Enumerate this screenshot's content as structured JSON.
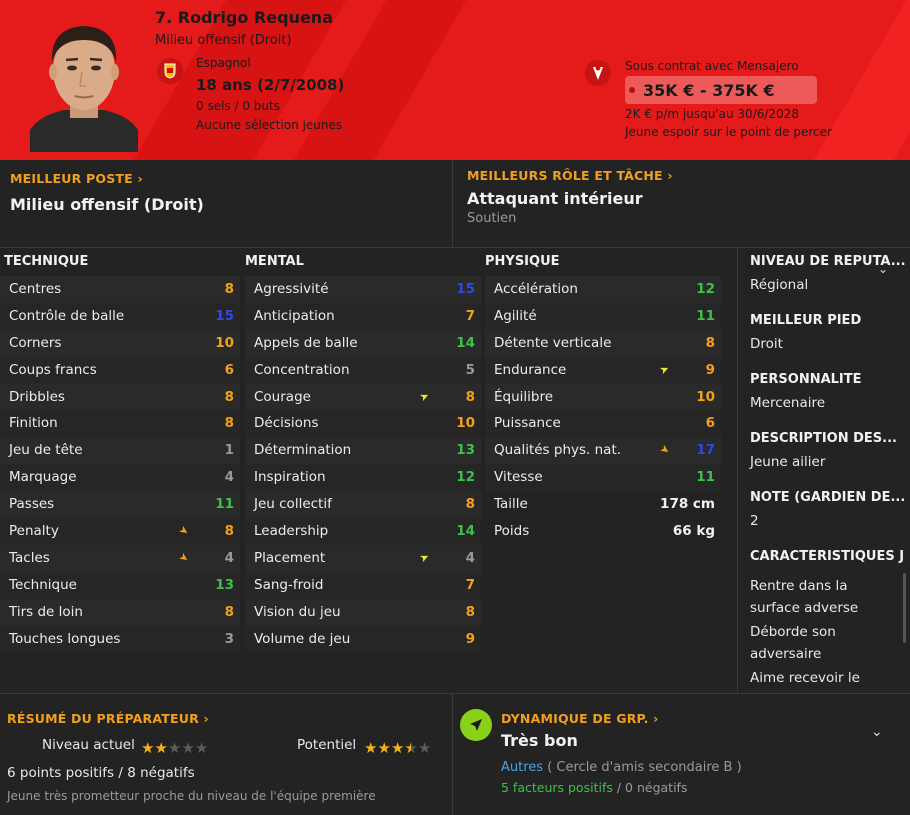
{
  "header": {
    "name": "7. Rodrigo Requena",
    "position": "Milieu offensif (Droit)",
    "nationality": "Espagnol",
    "age": "18 ans",
    "dob": "(2/7/2008)",
    "caps": "0 sels / 0 buts",
    "youth": "Aucune sélection jeunes",
    "contract": "Sous contrat avec Mensajero",
    "value": "35K € - 375K €",
    "wage": "2K € p/m jusqu'au 30/6/2028",
    "prospect": "Jeune espoir sur le point de percer"
  },
  "best_position": {
    "title": "MEILLEUR POSTE",
    "value": "Milieu offensif (Droit)"
  },
  "best_role": {
    "title": "MEILLEURS RÔLE ET TÂCHE",
    "value": "Attaquant intérieur",
    "duty": "Soutien"
  },
  "technique": {
    "title": "TECHNIQUE",
    "rows": [
      {
        "label": "Centres",
        "value": "8",
        "color": "or"
      },
      {
        "label": "Contrôle de balle",
        "value": "15",
        "color": "bl"
      },
      {
        "label": "Corners",
        "value": "10",
        "color": "or"
      },
      {
        "label": "Coups francs",
        "value": "6",
        "color": "or"
      },
      {
        "label": "Dribbles",
        "value": "8",
        "color": "or"
      },
      {
        "label": "Finition",
        "value": "8",
        "color": "or"
      },
      {
        "label": "Jeu de tête",
        "value": "1",
        "color": "gy"
      },
      {
        "label": "Marquage",
        "value": "4",
        "color": "gy"
      },
      {
        "label": "Passes",
        "value": "11",
        "color": "gr"
      },
      {
        "label": "Penalty",
        "value": "8",
        "color": "or",
        "arrow": "or"
      },
      {
        "label": "Tacles",
        "value": "4",
        "color": "gy",
        "arrow": "or"
      },
      {
        "label": "Technique",
        "value": "13",
        "color": "gr"
      },
      {
        "label": "Tirs de loin",
        "value": "8",
        "color": "or"
      },
      {
        "label": "Touches longues",
        "value": "3",
        "color": "gy"
      }
    ]
  },
  "mental": {
    "title": "MENTAL",
    "rows": [
      {
        "label": "Agressivité",
        "value": "15",
        "color": "bl"
      },
      {
        "label": "Anticipation",
        "value": "7",
        "color": "or"
      },
      {
        "label": "Appels de balle",
        "value": "14",
        "color": "gr"
      },
      {
        "label": "Concentration",
        "value": "5",
        "color": "gy"
      },
      {
        "label": "Courage",
        "value": "8",
        "color": "or",
        "arrow": "ye"
      },
      {
        "label": "Décisions",
        "value": "10",
        "color": "or"
      },
      {
        "label": "Détermination",
        "value": "13",
        "color": "gr"
      },
      {
        "label": "Inspiration",
        "value": "12",
        "color": "gr"
      },
      {
        "label": "Jeu collectif",
        "value": "8",
        "color": "or"
      },
      {
        "label": "Leadership",
        "value": "14",
        "color": "gr"
      },
      {
        "label": "Placement",
        "value": "4",
        "color": "gy",
        "arrow": "ye"
      },
      {
        "label": "Sang-froid",
        "value": "7",
        "color": "or"
      },
      {
        "label": "Vision du jeu",
        "value": "8",
        "color": "or"
      },
      {
        "label": "Volume de jeu",
        "value": "9",
        "color": "or"
      }
    ]
  },
  "physique": {
    "title": "PHYSIQUE",
    "rows": [
      {
        "label": "Accélération",
        "value": "12",
        "color": "gr"
      },
      {
        "label": "Agilité",
        "value": "11",
        "color": "gr"
      },
      {
        "label": "Détente verticale",
        "value": "8",
        "color": "or"
      },
      {
        "label": "Endurance",
        "value": "9",
        "color": "or",
        "arrow": "ye"
      },
      {
        "label": "Équilibre",
        "value": "10",
        "color": "or"
      },
      {
        "label": "Puissance",
        "value": "6",
        "color": "or"
      },
      {
        "label": "Qualités phys. nat.",
        "value": "17",
        "color": "bl",
        "arrow": "or"
      },
      {
        "label": "Vitesse",
        "value": "11",
        "color": "gr"
      }
    ],
    "height_label": "Taille",
    "height": "178 cm",
    "weight_label": "Poids",
    "weight": "66 kg"
  },
  "right": {
    "reputation_title": "NIVEAU DE RÉPUTA...",
    "reputation": "Régional",
    "foot_title": "MEILLEUR PIED",
    "foot": "Droit",
    "personality_title": "PERSONNALITÉ",
    "personality": "Mercenaire",
    "description_title": "DESCRIPTION DES...",
    "description": "Jeune ailier",
    "gk_title": "NOTE (GARDIEN DE...",
    "gk": "2",
    "traits_title": "CARACTÉRISTIQUES J",
    "traits": [
      "Rentre dans la surface adverse",
      "Déborde son adversaire",
      "Aime recevoir le"
    ]
  },
  "coach": {
    "title": "RÉSUMÉ DU PRÉPARATEUR",
    "current_label": "Niveau actuel",
    "current_stars": 2,
    "potential_label": "Potentiel",
    "potential_stars": 3.5,
    "points": "6 points positifs / 8 négatifs",
    "summary": "Jeune très prometteur proche du niveau de l'équipe première"
  },
  "dynamics": {
    "title": "DYNAMIQUE DE GRP.",
    "value": "Très bon",
    "group_link": "Autres",
    "group_detail": "( Cercle d'amis secondaire B )",
    "positive": "5 facteurs positifs",
    "negative": "/ 0 négatifs"
  },
  "colors": {
    "header": "#e51b1b",
    "accent": "#f0a020",
    "green": "#3cc24a",
    "blue": "#2f48e8",
    "link": "#4aa3e8"
  }
}
